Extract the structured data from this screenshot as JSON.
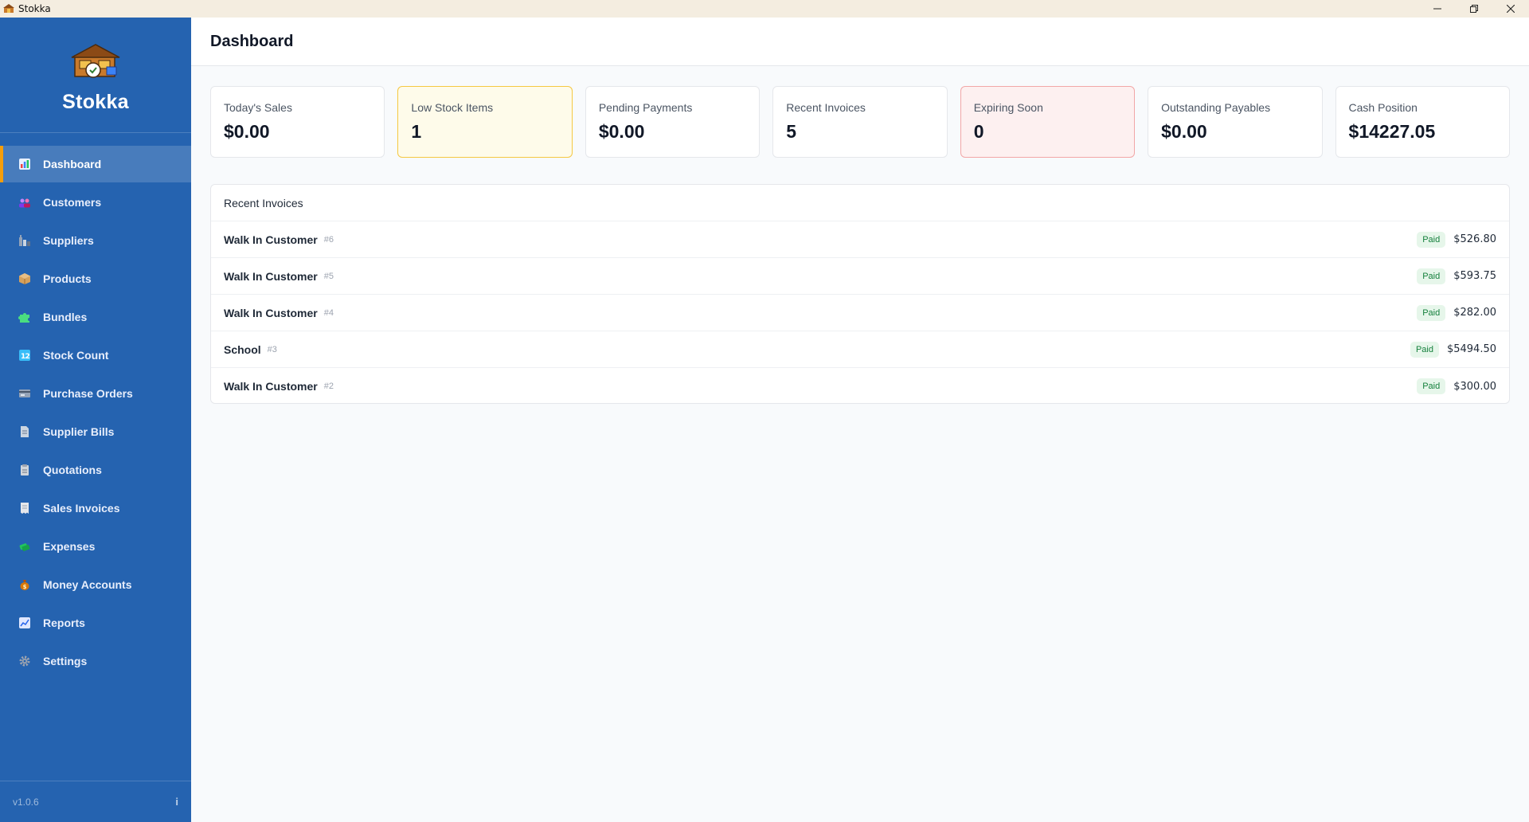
{
  "window": {
    "title": "Stokka"
  },
  "sidebar": {
    "brand": "Stokka",
    "items": [
      {
        "label": "Dashboard",
        "icon": "dashboard-icon",
        "active": true
      },
      {
        "label": "Customers",
        "icon": "customers-icon"
      },
      {
        "label": "Suppliers",
        "icon": "suppliers-icon"
      },
      {
        "label": "Products",
        "icon": "products-icon"
      },
      {
        "label": "Bundles",
        "icon": "bundles-icon"
      },
      {
        "label": "Stock Count",
        "icon": "stock-count-icon"
      },
      {
        "label": "Purchase Orders",
        "icon": "purchase-orders-icon"
      },
      {
        "label": "Supplier Bills",
        "icon": "supplier-bills-icon"
      },
      {
        "label": "Quotations",
        "icon": "quotations-icon"
      },
      {
        "label": "Sales Invoices",
        "icon": "sales-invoices-icon"
      },
      {
        "label": "Expenses",
        "icon": "expenses-icon"
      },
      {
        "label": "Money Accounts",
        "icon": "money-accounts-icon"
      },
      {
        "label": "Reports",
        "icon": "reports-icon"
      },
      {
        "label": "Settings",
        "icon": "settings-icon"
      }
    ],
    "version": "v1.0.6",
    "info": "i"
  },
  "header": {
    "title": "Dashboard"
  },
  "cards": [
    {
      "label": "Today's Sales",
      "value": "$0.00",
      "tone": "normal"
    },
    {
      "label": "Low Stock Items",
      "value": "1",
      "tone": "warn"
    },
    {
      "label": "Pending Payments",
      "value": "$0.00",
      "tone": "normal"
    },
    {
      "label": "Recent Invoices",
      "value": "5",
      "tone": "normal"
    },
    {
      "label": "Expiring Soon",
      "value": "0",
      "tone": "danger"
    },
    {
      "label": "Outstanding Payables",
      "value": "$0.00",
      "tone": "normal"
    },
    {
      "label": "Cash Position",
      "value": "$14227.05",
      "tone": "normal"
    }
  ],
  "recent": {
    "title": "Recent Invoices",
    "rows": [
      {
        "name": "Walk In Customer",
        "number": "#6",
        "status": "Paid",
        "amount": "$526.80"
      },
      {
        "name": "Walk In Customer",
        "number": "#5",
        "status": "Paid",
        "amount": "$593.75"
      },
      {
        "name": "Walk In Customer",
        "number": "#4",
        "status": "Paid",
        "amount": "$282.00"
      },
      {
        "name": "School",
        "number": "#3",
        "status": "Paid",
        "amount": "$5494.50"
      },
      {
        "name": "Walk In Customer",
        "number": "#2",
        "status": "Paid",
        "amount": "$300.00"
      }
    ]
  },
  "colors": {
    "sidebar": "#2563b0",
    "accent": "#f59e0b",
    "warn_bg": "#fefbea",
    "danger_bg": "#fdf0f0",
    "paid": "#15803d"
  }
}
